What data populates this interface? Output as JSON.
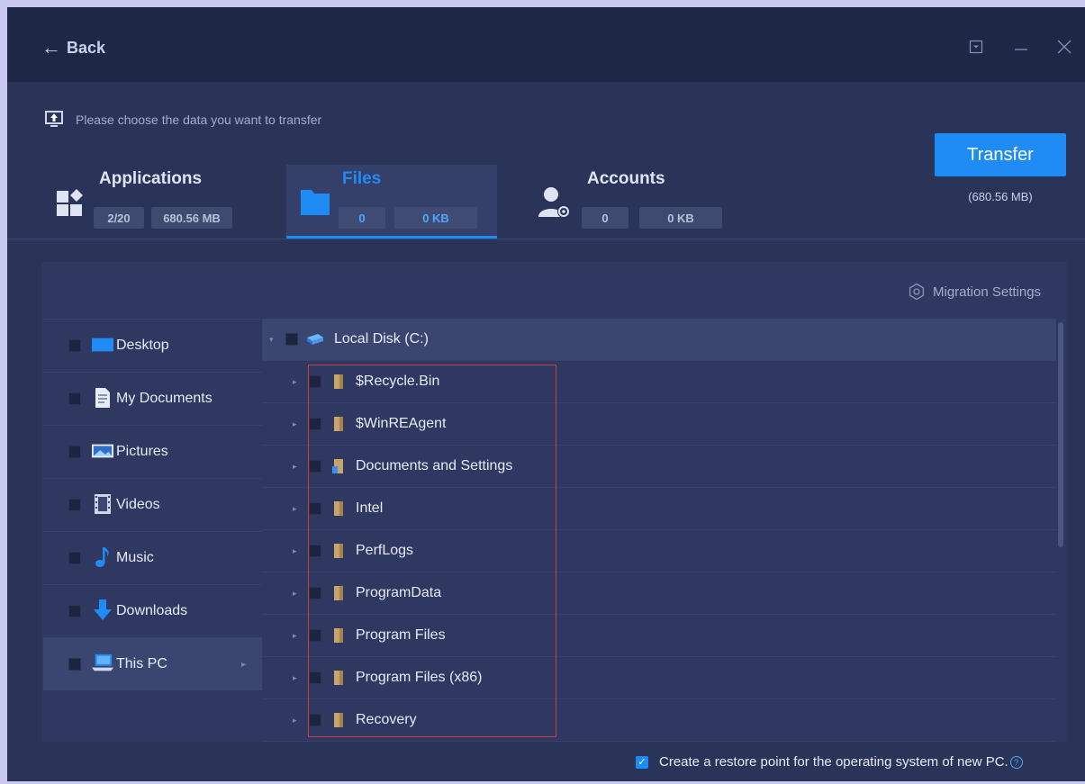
{
  "titlebar": {
    "back_label": "Back"
  },
  "header": {
    "hint": "Please choose the data you want to transfer",
    "tabs": [
      {
        "title": "Applications",
        "count": "2/20",
        "size": "680.56 MB"
      },
      {
        "title": "Files",
        "count": "0",
        "size": "0 KB"
      },
      {
        "title": "Accounts",
        "count": "0",
        "size": "0 KB"
      }
    ],
    "transfer_label": "Transfer",
    "transfer_size": "(680.56 MB)"
  },
  "panel": {
    "migration_settings": "Migration Settings",
    "sidebar": [
      {
        "label": "Desktop",
        "icon": "desktop-icon"
      },
      {
        "label": "My Documents",
        "icon": "documents-icon"
      },
      {
        "label": "Pictures",
        "icon": "pictures-icon"
      },
      {
        "label": "Videos",
        "icon": "videos-icon"
      },
      {
        "label": "Music",
        "icon": "music-note-icon"
      },
      {
        "label": "Downloads",
        "icon": "download-arrow-icon"
      },
      {
        "label": "This PC",
        "icon": "computer-icon"
      }
    ],
    "tree": {
      "root": "Local Disk (C:)",
      "folders": [
        "$Recycle.Bin",
        "$WinREAgent",
        "Documents and Settings",
        "Intel",
        "PerfLogs",
        "ProgramData",
        "Program Files",
        "Program Files (x86)",
        "Recovery"
      ]
    }
  },
  "footer": {
    "restore_label": "Create a restore point for the operating system of new PC."
  },
  "colors": {
    "accent": "#1f8cf5",
    "window_bg": "#2a3459",
    "titlebar_bg": "#1f2746",
    "highlight_box": "#d23b3b"
  }
}
